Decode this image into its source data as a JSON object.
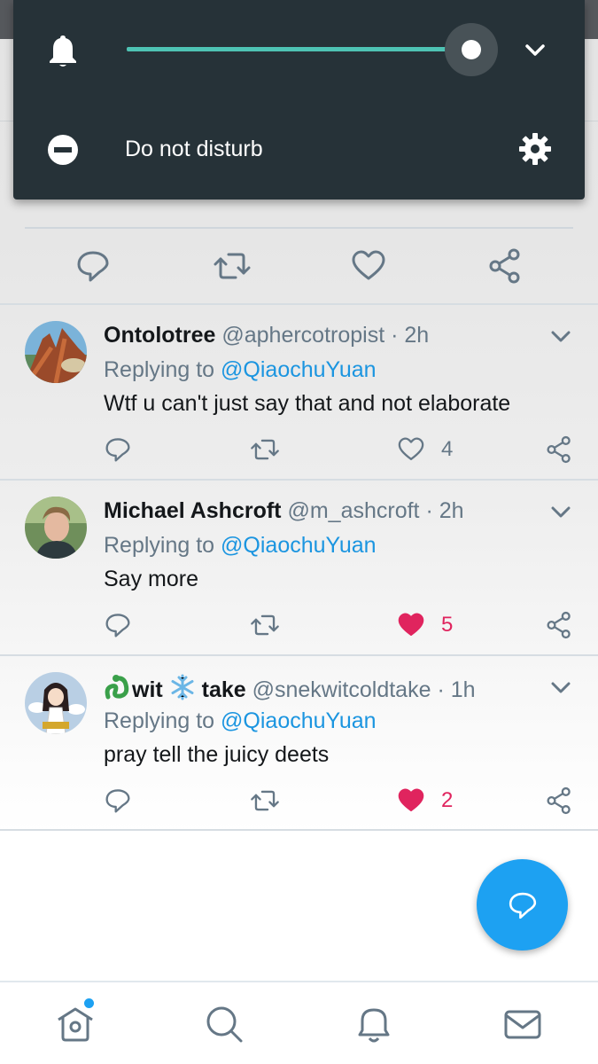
{
  "volume_panel": {
    "label": "Do not disturb",
    "volume_level": 1.0,
    "accent_color": "#4ec3b4",
    "icons": [
      "bell-icon",
      "minus-circle-icon",
      "chevron-down-icon",
      "gear-icon"
    ]
  },
  "tweets": [
    {
      "name": "Ontolotree",
      "handle": "@aphercotropist",
      "time": "2h",
      "replying_prefix": "Replying to",
      "replying_to": "@QiaochuYuan",
      "text": "Wtf u can't just say that and not elaborate",
      "likes": "4",
      "liked": false
    },
    {
      "name": "Michael Ashcroft",
      "handle": "@m_ashcroft",
      "time": "2h",
      "replying_prefix": "Replying to",
      "replying_to": "@QiaochuYuan",
      "text": "Say more",
      "likes": "5",
      "liked": true
    },
    {
      "name_part1": "wit",
      "name_part2": "take",
      "handle": "@snekwitcoldtake",
      "time": "1h",
      "replying_prefix": "Replying to",
      "replying_to": "@QiaochuYuan",
      "text": "pray tell the juicy deets",
      "likes": "2",
      "liked": true
    }
  ],
  "colors": {
    "twitter_blue": "#1da1f2",
    "like_red": "#e0245e",
    "secondary_text": "#657786"
  },
  "bottom_nav": [
    "home-icon",
    "search-icon",
    "notifications-icon",
    "messages-icon"
  ]
}
